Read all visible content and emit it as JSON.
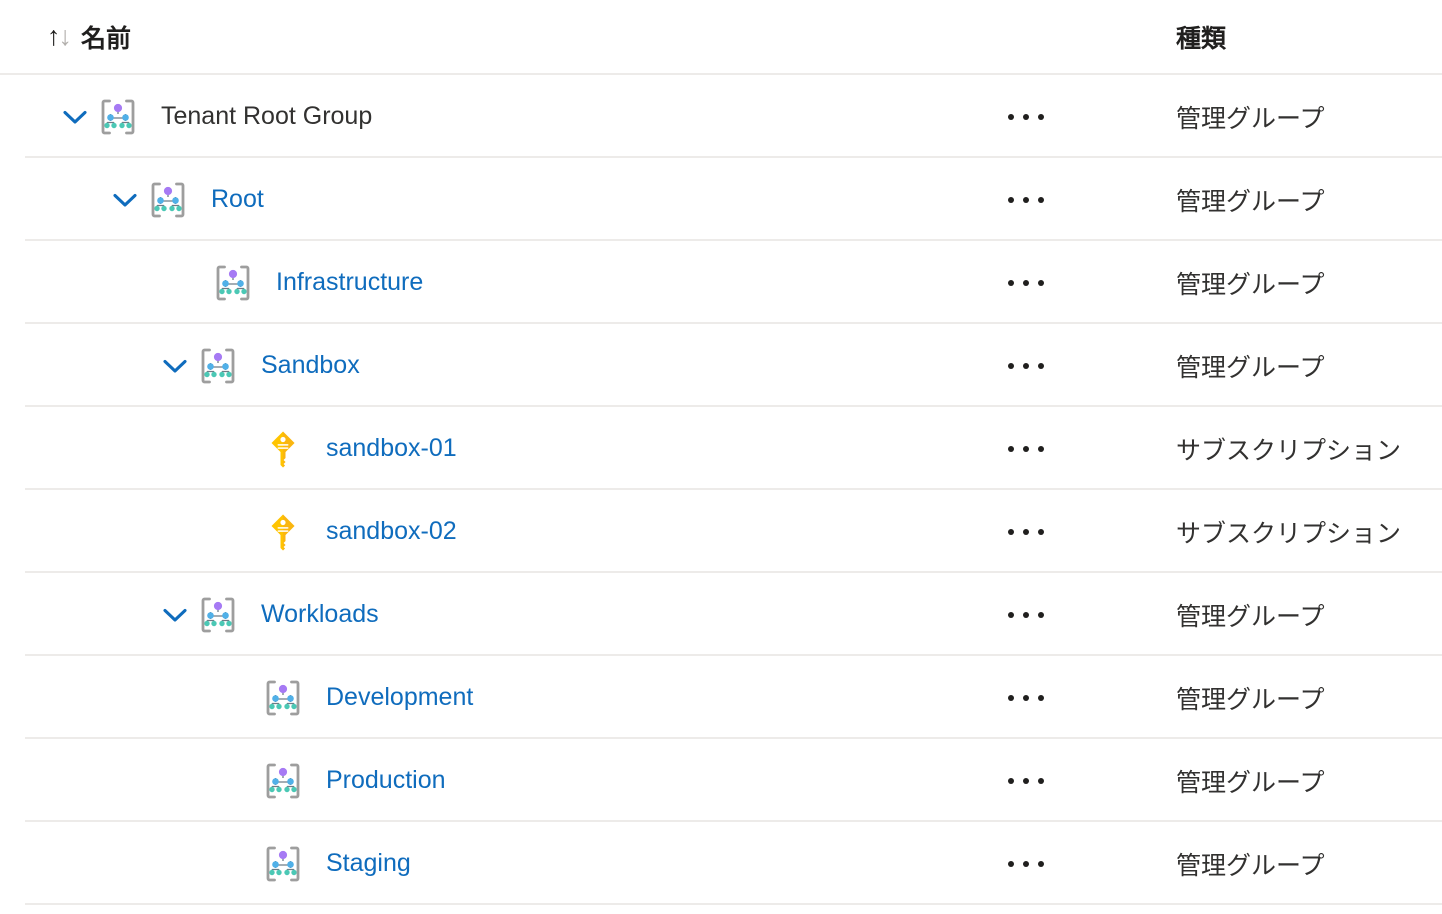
{
  "header": {
    "sort_asc_glyph": "↑",
    "sort_desc_glyph": "↓",
    "name_column": "名前",
    "type_column": "種類"
  },
  "labels": {
    "management_group": "管理グループ",
    "subscription": "サブスクリプション",
    "more_actions": "..."
  },
  "colors": {
    "link": "#0f6cbd",
    "text": "#323130",
    "divider": "#edebe9",
    "chevron": "#0f6cbd",
    "mg_node_top": "#a67af4",
    "mg_node_mid": "#50b0e8",
    "mg_node_leaf": "#4bc8b5",
    "mg_bracket": "#9e9e9e",
    "key_icon": "#ffc400"
  },
  "rows": [
    {
      "name": "Tenant Root Group",
      "type": "管理グループ",
      "icon": "management-group-icon",
      "is_link": false,
      "expanded": true,
      "has_chevron": true,
      "indent": 0
    },
    {
      "name": "Root",
      "type": "管理グループ",
      "icon": "management-group-icon",
      "is_link": true,
      "expanded": true,
      "has_chevron": true,
      "indent": 1
    },
    {
      "name": "Infrastructure",
      "type": "管理グループ",
      "icon": "management-group-icon",
      "is_link": true,
      "expanded": false,
      "has_chevron": false,
      "indent": 2
    },
    {
      "name": "Sandbox",
      "type": "管理グループ",
      "icon": "management-group-icon",
      "is_link": true,
      "expanded": true,
      "has_chevron": true,
      "indent": 2
    },
    {
      "name": "sandbox-01",
      "type": "サブスクリプション",
      "icon": "subscription-key-icon",
      "is_link": true,
      "expanded": false,
      "has_chevron": false,
      "indent": 3
    },
    {
      "name": "sandbox-02",
      "type": "サブスクリプション",
      "icon": "subscription-key-icon",
      "is_link": true,
      "expanded": false,
      "has_chevron": false,
      "indent": 3
    },
    {
      "name": "Workloads",
      "type": "管理グループ",
      "icon": "management-group-icon",
      "is_link": true,
      "expanded": true,
      "has_chevron": true,
      "indent": 2
    },
    {
      "name": "Development",
      "type": "管理グループ",
      "icon": "management-group-icon",
      "is_link": true,
      "expanded": false,
      "has_chevron": false,
      "indent": 3
    },
    {
      "name": "Production",
      "type": "管理グループ",
      "icon": "management-group-icon",
      "is_link": true,
      "expanded": false,
      "has_chevron": false,
      "indent": 3
    },
    {
      "name": "Staging",
      "type": "管理グループ",
      "icon": "management-group-icon",
      "is_link": true,
      "expanded": false,
      "has_chevron": false,
      "indent": 3
    }
  ]
}
